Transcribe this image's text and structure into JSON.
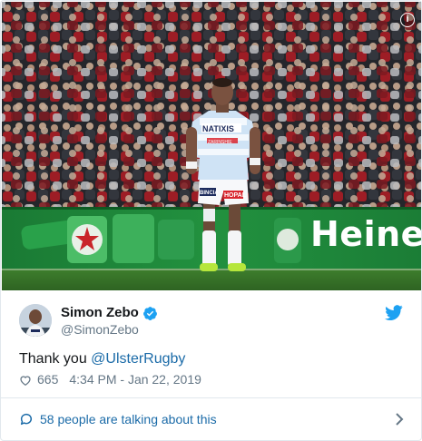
{
  "tweet": {
    "display_name": "Simon Zebo",
    "handle": "@SimonZebo",
    "text_prefix": "Thank you ",
    "mention": "@UlsterRugby",
    "likes": "665",
    "timestamp": "4:34 PM - Jan 22, 2019",
    "talking": "58 people are talking about this",
    "verified": true
  },
  "photo": {
    "banner_text": "Heine",
    "info_symbol": "i",
    "shirt_sponsor": "NATIXIS",
    "shorts_sponsor_left": "BINCIA",
    "shorts_sponsor_right": "HOPAL",
    "chest_text": "ZARINSHIE"
  },
  "icons": {
    "verified": "verified-badge-icon",
    "twitter": "twitter-bird-icon",
    "heart": "heart-icon",
    "bubble": "speech-bubble-icon",
    "chevron": "chevron-right-icon",
    "info": "info-icon"
  },
  "colors": {
    "link": "#1b6ba8",
    "twitter_blue": "#1da1f2",
    "secondary_text": "#657786",
    "banner_green": "#1f8a3c"
  }
}
